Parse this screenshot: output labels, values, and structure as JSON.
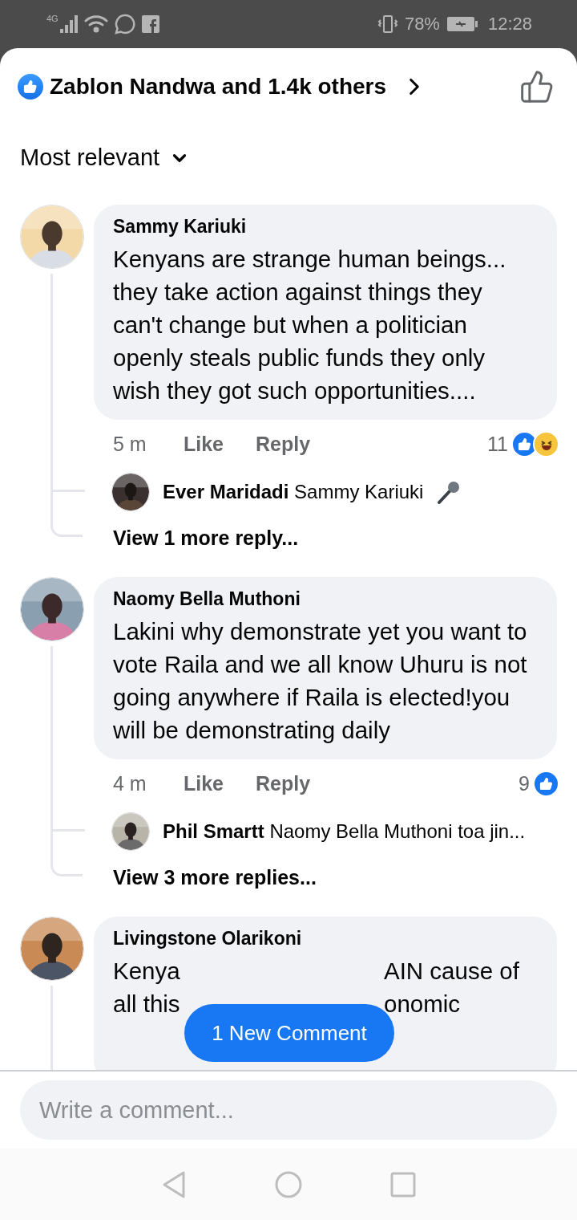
{
  "status_bar": {
    "network": "4G",
    "battery": "78%",
    "time": "12:28"
  },
  "header": {
    "reactors": "Zablon Nandwa and 1.4k others"
  },
  "sort": {
    "label": "Most relevant"
  },
  "comments": [
    {
      "author": "Sammy Kariuki",
      "text": "Kenyans are strange human beings... they take action against things they can't change but when a politician openly steals public funds they only wish they got such opportunities....",
      "time": "5 m",
      "like": "Like",
      "reply": "Reply",
      "reaction_count": "11",
      "reactions": [
        {
          "kind": "like"
        },
        {
          "kind": "haha"
        }
      ],
      "reply_preview": {
        "author": "Ever Maridadi",
        "text": "Sammy Kariuki",
        "emoji": {
          "kind": "microphone"
        }
      },
      "view_more": "View 1 more reply..."
    },
    {
      "author": "Naomy Bella Muthoni",
      "text": "Lakini why demonstrate yet you want to vote Raila and we all know Uhuru is not going anywhere if Raila is elected!you will be demonstrating daily",
      "time": "4 m",
      "like": "Like",
      "reply": "Reply",
      "reaction_count": "9",
      "reactions": [
        {
          "kind": "like"
        }
      ],
      "reply_preview": {
        "author": "Phil Smartt",
        "text": "Naomy Bella Muthoni toa jin..."
      },
      "view_more": "View 3 more replies..."
    },
    {
      "author": "Livingstone Olarikoni",
      "text_parts": [
        {
          "left": "Kenya",
          "right": "AIN cause of"
        },
        {
          "left": "all this",
          "right": "onomic"
        }
      ]
    }
  ],
  "new_comment_pill": {
    "label": "1 New Comment"
  },
  "composer": {
    "placeholder": "Write a comment..."
  }
}
